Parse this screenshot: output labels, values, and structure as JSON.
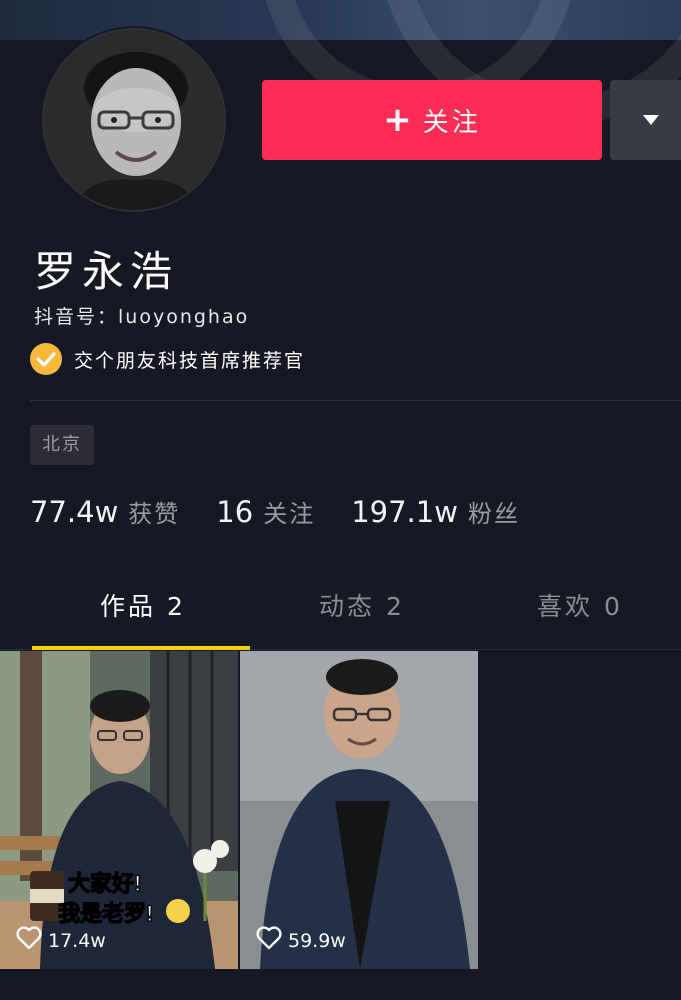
{
  "profile": {
    "name": "罗永浩",
    "account": "抖音号：luoyonghao",
    "verification": "交个朋友科技首席推荐官",
    "location_tag": "北京"
  },
  "actions": {
    "follow_label": "关注",
    "follow_plus": "+",
    "more_icon": "caret-down-icon"
  },
  "stats": [
    {
      "value": "77.4w",
      "label": "获赞"
    },
    {
      "value": "16",
      "label": "关注"
    },
    {
      "value": "197.1w",
      "label": "粉丝"
    }
  ],
  "tabs": [
    {
      "label": "作品 2",
      "active": true
    },
    {
      "label": "动态 2",
      "active": false
    },
    {
      "label": "喜欢 0",
      "active": false
    }
  ],
  "videos": [
    {
      "likes": "17.4w",
      "caption": "大家好！我是老罗！"
    },
    {
      "likes": "59.9w",
      "caption": ""
    }
  ],
  "colors": {
    "background": "#161823",
    "follow_button": "#fe2c55",
    "tab_indicator": "#facd00",
    "verify_badge": "#f6b93b"
  }
}
